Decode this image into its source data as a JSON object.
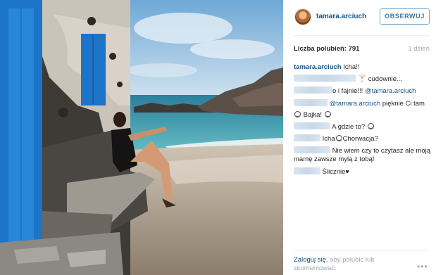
{
  "post": {
    "username": "tamara.arciuch",
    "follow_label": "OBSERWUJ",
    "likes_label": "Liczba polubień:",
    "likes_count": "791",
    "time_ago": "1 dzień"
  },
  "comments": [
    {
      "user": "tamara.arciuch",
      "text": "Icha!!"
    },
    {
      "icon": "cocktail-icon",
      "text": "cudownie..."
    },
    {
      "text": "o i fajnie!!!",
      "mention": "@tamara.arciuch"
    },
    {
      "mention": "@tamara.arciuch",
      "text": "pięknie Ci tam"
    },
    {
      "text": "Bajka!",
      "icon": "smile-icon"
    },
    {
      "text": "A gdzie to?",
      "icon": "smile-icon"
    },
    {
      "text": "Icha",
      "text2": "Chorwacja?",
      "icon": "smile-icon"
    },
    {
      "text": "Nie wiem czy to czytasz ale moją",
      "text2": "mamę zawsze mylą z tobą!"
    },
    {
      "text": "Ślicznie",
      "icon": "heart-icon"
    }
  ],
  "footer": {
    "login_link": "Zaloguj się",
    "login_text": ", aby polubić lub skomentować.",
    "more_label": "•••"
  },
  "colors": {
    "link": "#125688",
    "follow_border": "#70a5cf",
    "muted": "#a5a7aa"
  }
}
